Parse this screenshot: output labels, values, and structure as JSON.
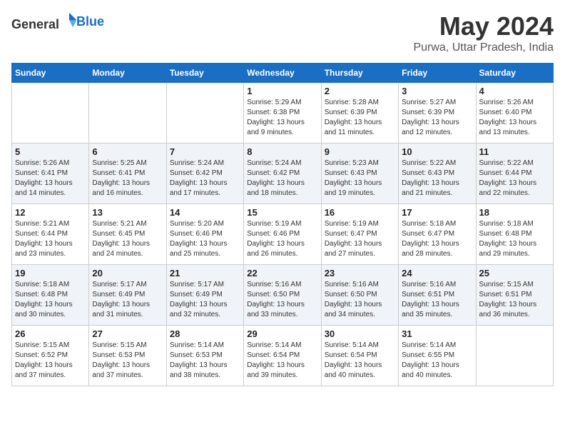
{
  "header": {
    "logo_general": "General",
    "logo_blue": "Blue",
    "title": "May 2024",
    "subtitle": "Purwa, Uttar Pradesh, India"
  },
  "days_of_week": [
    "Sunday",
    "Monday",
    "Tuesday",
    "Wednesday",
    "Thursday",
    "Friday",
    "Saturday"
  ],
  "weeks": [
    [
      {
        "day": "",
        "info": ""
      },
      {
        "day": "",
        "info": ""
      },
      {
        "day": "",
        "info": ""
      },
      {
        "day": "1",
        "info": "Sunrise: 5:29 AM\nSunset: 6:38 PM\nDaylight: 13 hours\nand 9 minutes."
      },
      {
        "day": "2",
        "info": "Sunrise: 5:28 AM\nSunset: 6:39 PM\nDaylight: 13 hours\nand 11 minutes."
      },
      {
        "day": "3",
        "info": "Sunrise: 5:27 AM\nSunset: 6:39 PM\nDaylight: 13 hours\nand 12 minutes."
      },
      {
        "day": "4",
        "info": "Sunrise: 5:26 AM\nSunset: 6:40 PM\nDaylight: 13 hours\nand 13 minutes."
      }
    ],
    [
      {
        "day": "5",
        "info": "Sunrise: 5:26 AM\nSunset: 6:41 PM\nDaylight: 13 hours\nand 14 minutes."
      },
      {
        "day": "6",
        "info": "Sunrise: 5:25 AM\nSunset: 6:41 PM\nDaylight: 13 hours\nand 16 minutes."
      },
      {
        "day": "7",
        "info": "Sunrise: 5:24 AM\nSunset: 6:42 PM\nDaylight: 13 hours\nand 17 minutes."
      },
      {
        "day": "8",
        "info": "Sunrise: 5:24 AM\nSunset: 6:42 PM\nDaylight: 13 hours\nand 18 minutes."
      },
      {
        "day": "9",
        "info": "Sunrise: 5:23 AM\nSunset: 6:43 PM\nDaylight: 13 hours\nand 19 minutes."
      },
      {
        "day": "10",
        "info": "Sunrise: 5:22 AM\nSunset: 6:43 PM\nDaylight: 13 hours\nand 21 minutes."
      },
      {
        "day": "11",
        "info": "Sunrise: 5:22 AM\nSunset: 6:44 PM\nDaylight: 13 hours\nand 22 minutes."
      }
    ],
    [
      {
        "day": "12",
        "info": "Sunrise: 5:21 AM\nSunset: 6:44 PM\nDaylight: 13 hours\nand 23 minutes."
      },
      {
        "day": "13",
        "info": "Sunrise: 5:21 AM\nSunset: 6:45 PM\nDaylight: 13 hours\nand 24 minutes."
      },
      {
        "day": "14",
        "info": "Sunrise: 5:20 AM\nSunset: 6:46 PM\nDaylight: 13 hours\nand 25 minutes."
      },
      {
        "day": "15",
        "info": "Sunrise: 5:19 AM\nSunset: 6:46 PM\nDaylight: 13 hours\nand 26 minutes."
      },
      {
        "day": "16",
        "info": "Sunrise: 5:19 AM\nSunset: 6:47 PM\nDaylight: 13 hours\nand 27 minutes."
      },
      {
        "day": "17",
        "info": "Sunrise: 5:18 AM\nSunset: 6:47 PM\nDaylight: 13 hours\nand 28 minutes."
      },
      {
        "day": "18",
        "info": "Sunrise: 5:18 AM\nSunset: 6:48 PM\nDaylight: 13 hours\nand 29 minutes."
      }
    ],
    [
      {
        "day": "19",
        "info": "Sunrise: 5:18 AM\nSunset: 6:48 PM\nDaylight: 13 hours\nand 30 minutes."
      },
      {
        "day": "20",
        "info": "Sunrise: 5:17 AM\nSunset: 6:49 PM\nDaylight: 13 hours\nand 31 minutes."
      },
      {
        "day": "21",
        "info": "Sunrise: 5:17 AM\nSunset: 6:49 PM\nDaylight: 13 hours\nand 32 minutes."
      },
      {
        "day": "22",
        "info": "Sunrise: 5:16 AM\nSunset: 6:50 PM\nDaylight: 13 hours\nand 33 minutes."
      },
      {
        "day": "23",
        "info": "Sunrise: 5:16 AM\nSunset: 6:50 PM\nDaylight: 13 hours\nand 34 minutes."
      },
      {
        "day": "24",
        "info": "Sunrise: 5:16 AM\nSunset: 6:51 PM\nDaylight: 13 hours\nand 35 minutes."
      },
      {
        "day": "25",
        "info": "Sunrise: 5:15 AM\nSunset: 6:51 PM\nDaylight: 13 hours\nand 36 minutes."
      }
    ],
    [
      {
        "day": "26",
        "info": "Sunrise: 5:15 AM\nSunset: 6:52 PM\nDaylight: 13 hours\nand 37 minutes."
      },
      {
        "day": "27",
        "info": "Sunrise: 5:15 AM\nSunset: 6:53 PM\nDaylight: 13 hours\nand 37 minutes."
      },
      {
        "day": "28",
        "info": "Sunrise: 5:14 AM\nSunset: 6:53 PM\nDaylight: 13 hours\nand 38 minutes."
      },
      {
        "day": "29",
        "info": "Sunrise: 5:14 AM\nSunset: 6:54 PM\nDaylight: 13 hours\nand 39 minutes."
      },
      {
        "day": "30",
        "info": "Sunrise: 5:14 AM\nSunset: 6:54 PM\nDaylight: 13 hours\nand 40 minutes."
      },
      {
        "day": "31",
        "info": "Sunrise: 5:14 AM\nSunset: 6:55 PM\nDaylight: 13 hours\nand 40 minutes."
      },
      {
        "day": "",
        "info": ""
      }
    ]
  ]
}
